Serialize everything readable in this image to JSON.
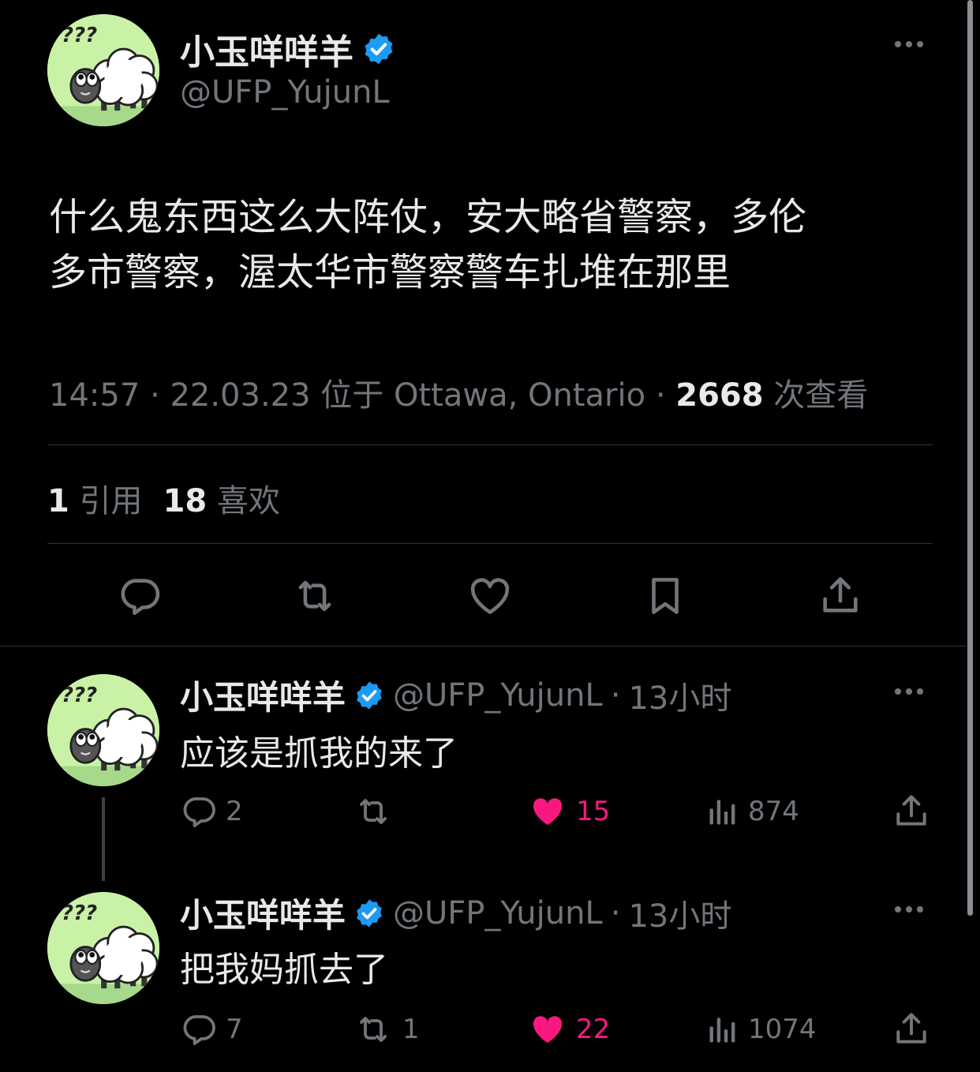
{
  "main_tweet": {
    "author_name": "小玉咩咩羊",
    "handle": "@UFP_YujunL",
    "text_line1": "什么鬼东西这么大阵仗，安大略省警察，多伦",
    "text_line2": "多市警察，渥太华市警察警车扎堆在那里",
    "time": "14:57",
    "date": "22.03.23",
    "location_prefix": "位于",
    "location": "Ottawa, Ontario",
    "views_count": "2668",
    "views_label": "次查看",
    "quotes_count": "1",
    "quotes_label": "引用",
    "likes_count": "18",
    "likes_label": "喜欢"
  },
  "replies": [
    {
      "author_name": "小玉咩咩羊",
      "handle": "@UFP_YujunL",
      "age": "13小时",
      "text": "应该是抓我的来了",
      "reply_count": "2",
      "retweet_count": "",
      "like_count": "15",
      "view_count": "874"
    },
    {
      "author_name": "小玉咩咩羊",
      "handle": "@UFP_YujunL",
      "age": "13小时",
      "text": "把我妈抓去了",
      "reply_count": "7",
      "retweet_count": "1",
      "like_count": "22",
      "view_count": "1074"
    }
  ],
  "separator": "·",
  "avatar_text": "???",
  "colors": {
    "background": "#000000",
    "text": "#e7e9ea",
    "muted": "#71767b",
    "verified": "#1d9bf0",
    "like": "#f91880",
    "avatar_bg": "#c9f2a6"
  }
}
